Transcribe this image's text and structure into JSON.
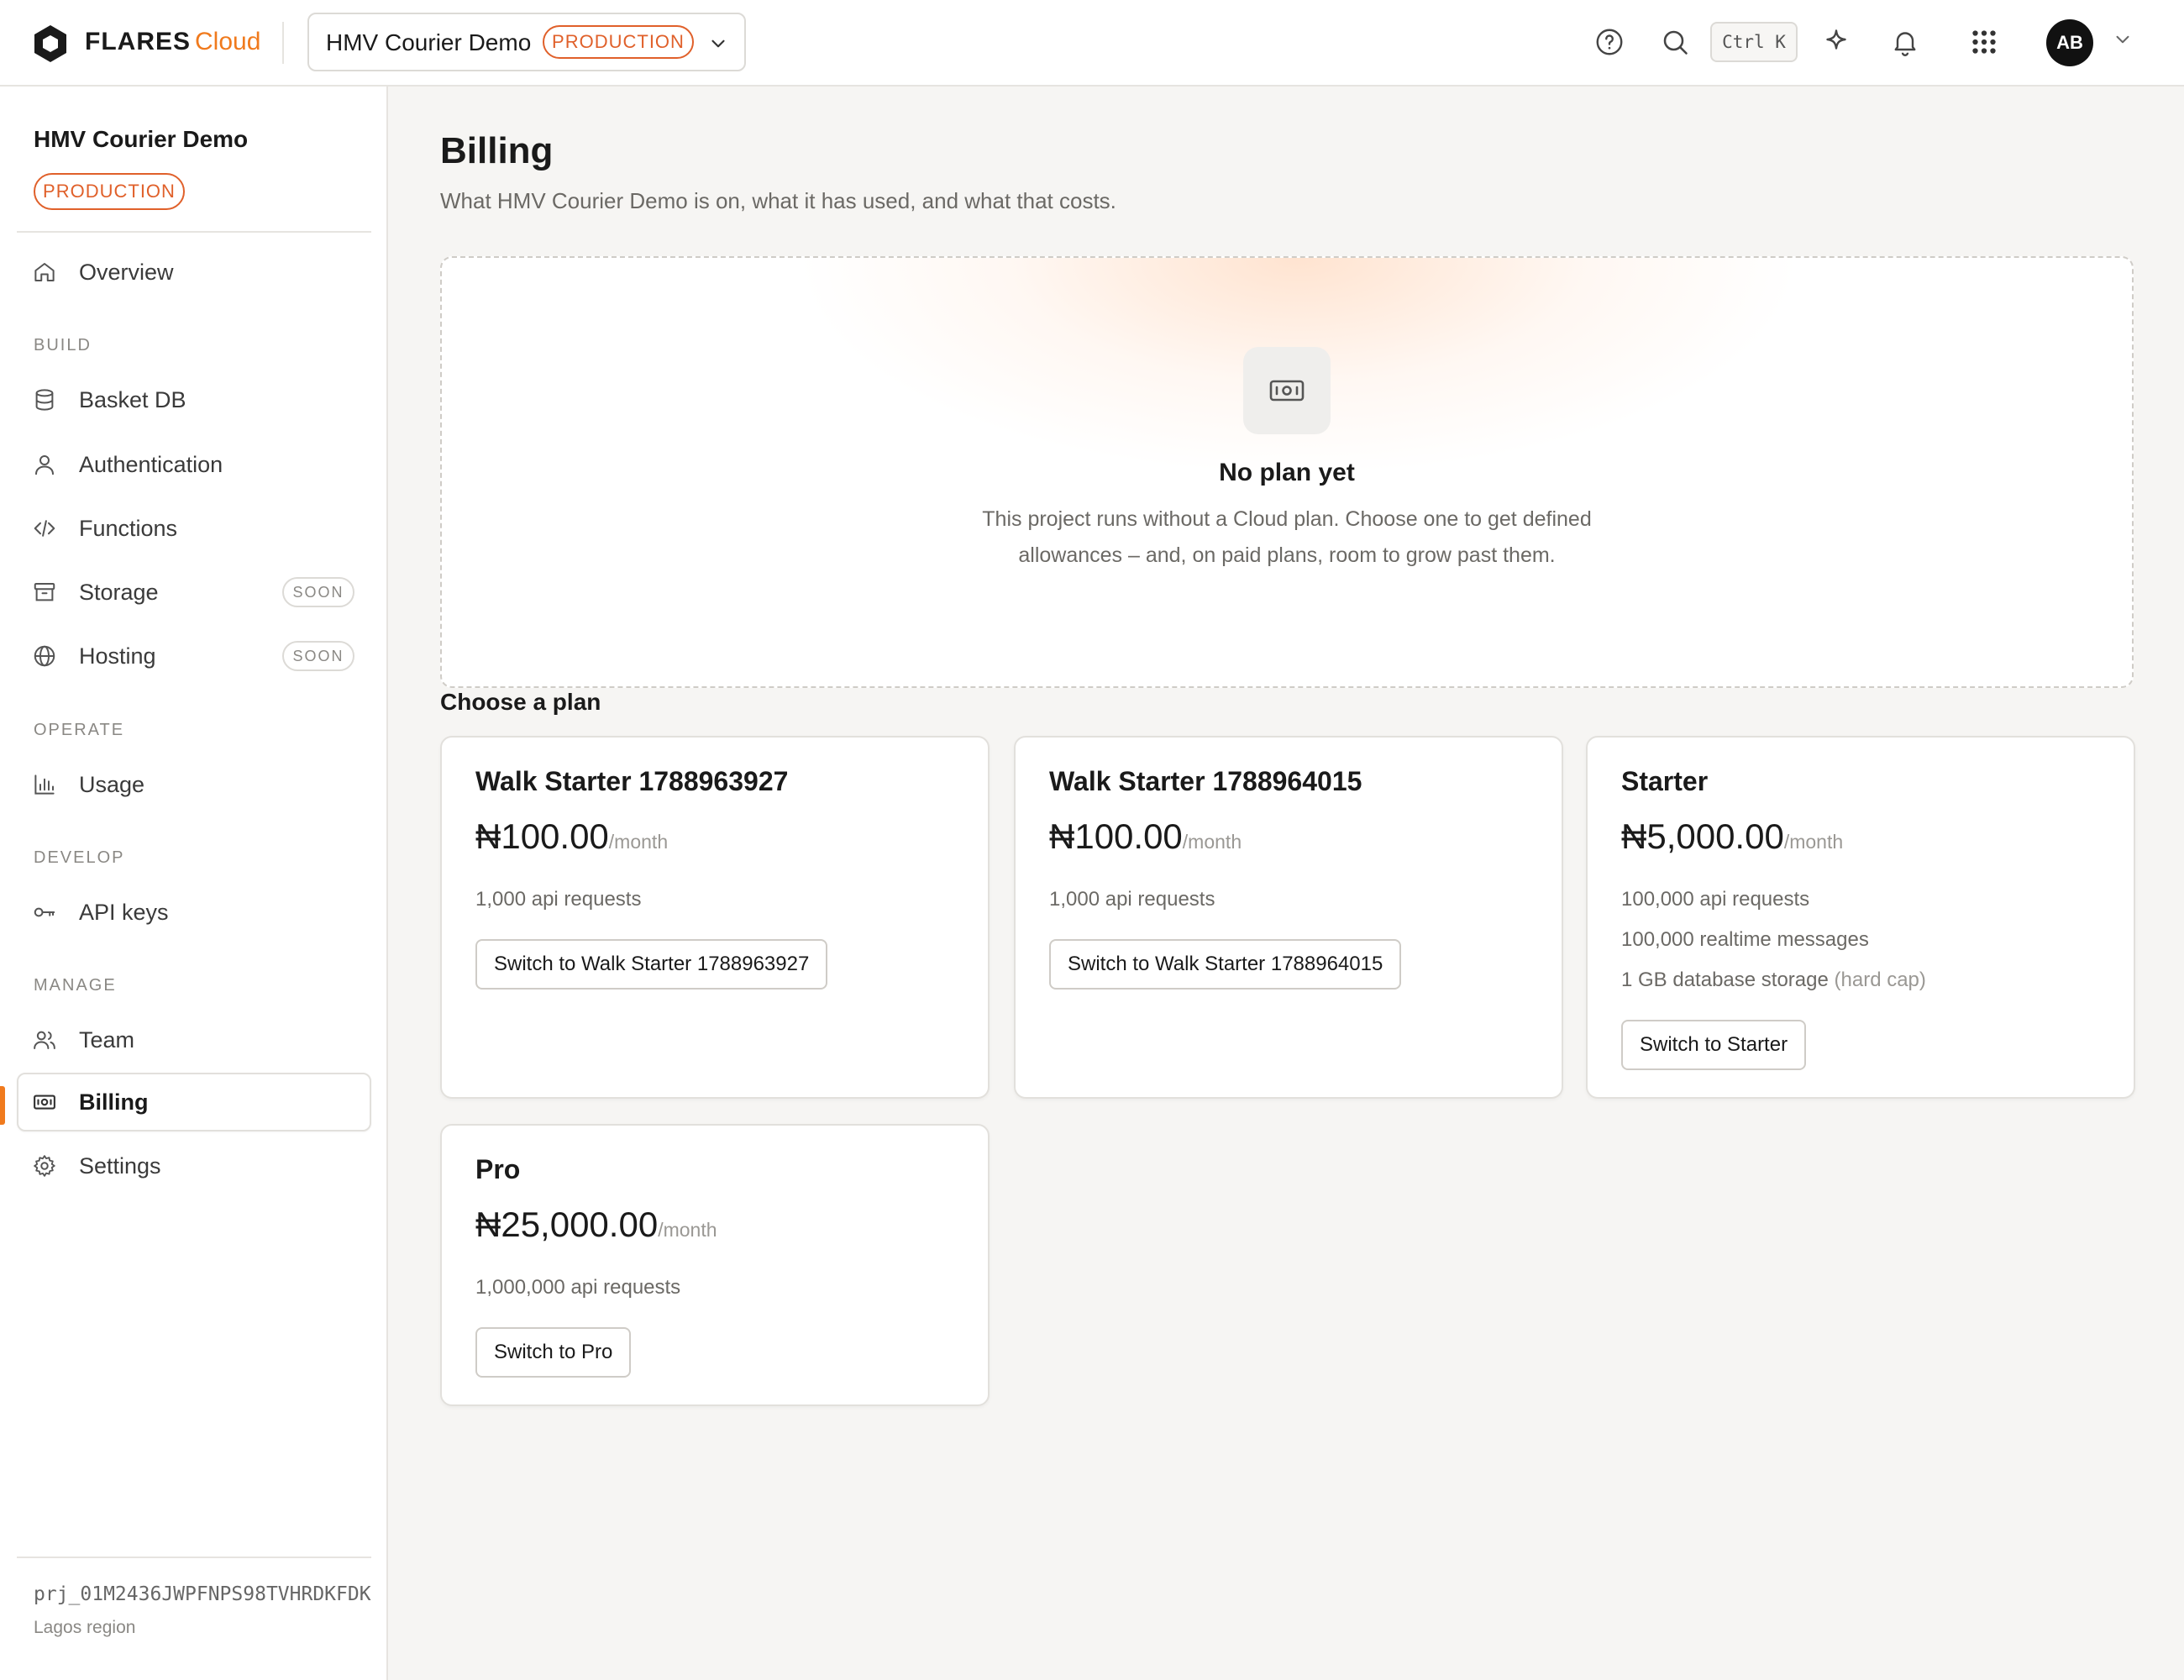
{
  "topbar": {
    "brand": "FLARES",
    "brand_suffix": "Cloud",
    "project_name": "HMV Courier Demo",
    "env_badge": "PRODUCTION",
    "shortcut": "Ctrl K",
    "avatar_initials": "AB",
    "icons": [
      "help-icon",
      "search-icon",
      "sparkle-icon",
      "bell-icon",
      "apps-grid-icon",
      "chevron-down-icon"
    ]
  },
  "sidebar": {
    "project_name": "HMV Courier Demo",
    "env_badge": "PRODUCTION",
    "overview": "Overview",
    "sections": {
      "build": "BUILD",
      "operate": "OPERATE",
      "develop": "DEVELOP",
      "manage": "MANAGE"
    },
    "items": {
      "basket_db": "Basket DB",
      "authentication": "Authentication",
      "functions": "Functions",
      "storage": "Storage",
      "hosting": "Hosting",
      "usage": "Usage",
      "api_keys": "API keys",
      "team": "Team",
      "billing": "Billing",
      "settings": "Settings"
    },
    "soon_badge": "SOON",
    "active_item": "Billing",
    "project_id": "prj_01M2436JWPFNPS98TVHRDKFDK",
    "region": "Lagos region"
  },
  "main": {
    "title": "Billing",
    "subtitle": "What HMV Courier Demo is on, what it has used, and what that costs.",
    "empty": {
      "title": "No plan yet",
      "description": "This project runs without a Cloud plan. Choose one to get defined allowances – and, on paid plans, room to grow past them."
    },
    "choose_heading": "Choose a plan",
    "plans": [
      {
        "name": "Walk Starter 1788963927",
        "price": "₦100.00",
        "period": "/month",
        "features": [
          "1,000 api requests"
        ],
        "button": "Switch to Walk Starter 1788963927"
      },
      {
        "name": "Walk Starter 1788964015",
        "price": "₦100.00",
        "period": "/month",
        "features": [
          "1,000 api requests"
        ],
        "button": "Switch to Walk Starter 1788964015"
      },
      {
        "name": "Starter",
        "price": "₦5,000.00",
        "period": "/month",
        "features": [
          "100,000 api requests",
          "100,000 realtime messages",
          "1 GB database storage"
        ],
        "feature_note": "(hard cap)",
        "button": "Switch to Starter"
      },
      {
        "name": "Pro",
        "price": "₦25,000.00",
        "period": "/month",
        "features": [
          "1,000,000 api requests"
        ],
        "button": "Switch to Pro"
      }
    ]
  },
  "colors": {
    "accent": "#f07a1d",
    "production_badge": "#e0602a",
    "background": "#f6f5f3"
  }
}
